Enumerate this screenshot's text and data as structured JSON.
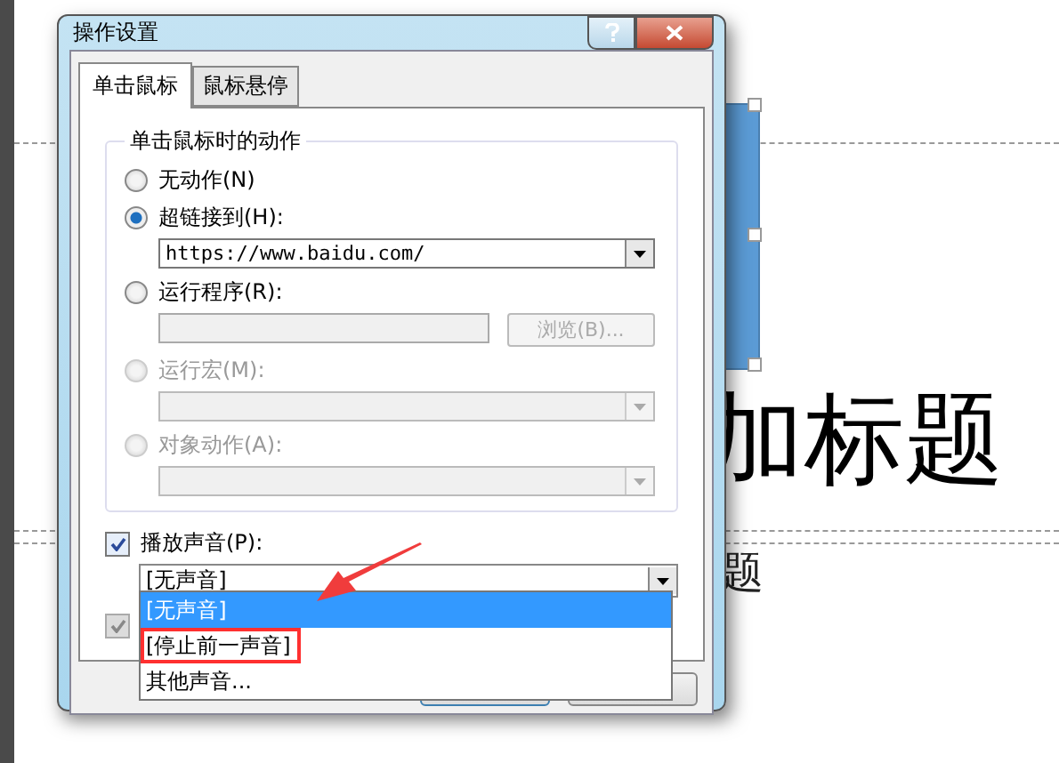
{
  "slide": {
    "title": "加标题",
    "subtitle": "题"
  },
  "dialog": {
    "title": "操作设置",
    "tabs": [
      {
        "label": "单击鼠标",
        "selected": true
      },
      {
        "label": "鼠标悬停",
        "selected": false
      }
    ],
    "group": {
      "title": "单击鼠标时的动作",
      "options": [
        {
          "kind": "plain",
          "label": "无动作(N)",
          "selected": false,
          "disabled": false
        },
        {
          "kind": "combo",
          "label": "超链接到(H):",
          "selected": true,
          "disabled": false,
          "value": "https://www.baidu.com/"
        },
        {
          "kind": "browse",
          "label": "运行程序(R):",
          "selected": false,
          "disabled": false,
          "button": "浏览(B)..."
        },
        {
          "kind": "combo",
          "label": "运行宏(M):",
          "selected": false,
          "disabled": true
        },
        {
          "kind": "combo",
          "label": "对象动作(A):",
          "selected": false,
          "disabled": true
        }
      ]
    },
    "sound": {
      "label": "播放声音(P):",
      "checked": true,
      "value": "[无声音]",
      "list": [
        {
          "label": "[无声音]",
          "selected": true,
          "highlighted": false
        },
        {
          "label": "[停止前一声音]",
          "selected": false,
          "highlighted": true
        },
        {
          "label": "其他声音...",
          "selected": false,
          "highlighted": false
        }
      ]
    },
    "second_checkbox": {
      "checked": true,
      "disabled": true
    }
  }
}
